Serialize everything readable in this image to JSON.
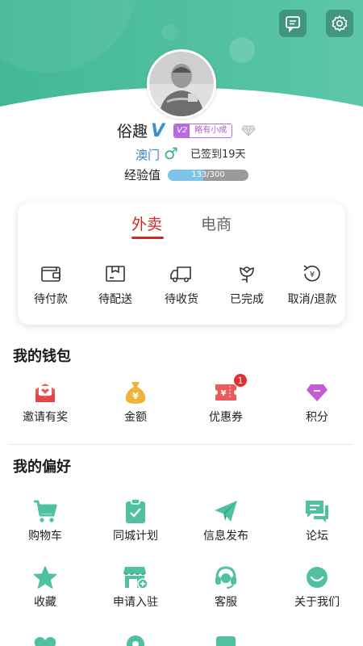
{
  "header": {
    "message_icon": "message-icon",
    "settings_icon": "gear-icon",
    "theme_color": "#4fc0a0"
  },
  "profile": {
    "username": "俗趣",
    "verified_mark": "V",
    "level": "V2",
    "level_title": "略有小成",
    "location": "澳门",
    "gender_symbol": "♂",
    "signin_text": "已签到19天",
    "exp_label": "经验值",
    "exp_current": 133,
    "exp_max": 300,
    "exp_text": "133/300"
  },
  "orders": {
    "tabs": [
      {
        "label": "外卖",
        "active": true
      },
      {
        "label": "电商",
        "active": false
      }
    ],
    "items": [
      {
        "label": "待付款",
        "icon": "wallet-icon"
      },
      {
        "label": "待配送",
        "icon": "package-icon"
      },
      {
        "label": "待收货",
        "icon": "truck-icon"
      },
      {
        "label": "已完成",
        "icon": "flower-icon"
      },
      {
        "label": "取消/退款",
        "icon": "refund-icon"
      }
    ]
  },
  "wallet": {
    "title": "我的钱包",
    "items": [
      {
        "label": "邀请有奖",
        "icon": "gift-icon",
        "color": "#ea5c5c"
      },
      {
        "label": "金额",
        "icon": "money-bag-icon",
        "color": "#f0b43c"
      },
      {
        "label": "优惠券",
        "icon": "coupon-icon",
        "color": "#ea5c5c",
        "badge": "1"
      },
      {
        "label": "积分",
        "icon": "diamond-icon",
        "color": "#c55ad9"
      }
    ]
  },
  "preferences": {
    "title": "我的偏好",
    "color": "#4fc0a0",
    "items": [
      {
        "label": "购物车",
        "icon": "cart-icon"
      },
      {
        "label": "同城计划",
        "icon": "clipboard-icon"
      },
      {
        "label": "信息发布",
        "icon": "paper-plane-icon"
      },
      {
        "label": "论坛",
        "icon": "chat-icon"
      },
      {
        "label": "收藏",
        "icon": "star-icon"
      },
      {
        "label": "申请入驻",
        "icon": "store-icon"
      },
      {
        "label": "客服",
        "icon": "headset-icon"
      },
      {
        "label": "关于我们",
        "icon": "smile-icon"
      }
    ]
  }
}
